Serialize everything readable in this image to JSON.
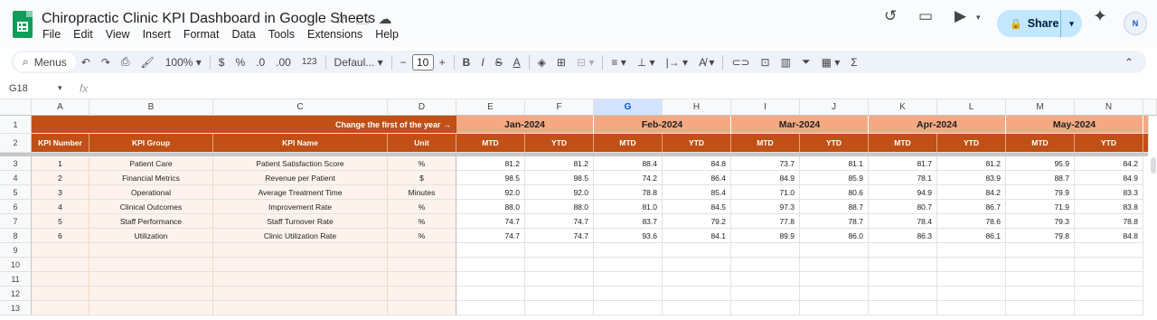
{
  "app": {
    "doc_title": "Chiropractic Clinic KPI Dashboard in Google Sheets",
    "menu": [
      "File",
      "Edit",
      "View",
      "Insert",
      "Format",
      "Data",
      "Tools",
      "Extensions",
      "Help"
    ],
    "share_label": "Share",
    "avatar_text": "N"
  },
  "toolbar": {
    "menus_label": "Menus",
    "zoom": "100%",
    "currency": "$",
    "percent": "%",
    "dec_decrease": ".0",
    "dec_increase": ".00",
    "number_format": "123",
    "font": "Defaul...",
    "font_size": "10"
  },
  "formula_bar": {
    "cell_ref": "G18",
    "fx": "fx"
  },
  "columns": [
    "A",
    "B",
    "C",
    "D",
    "E",
    "F",
    "G",
    "H",
    "I",
    "J",
    "K",
    "L",
    "M",
    "N"
  ],
  "selected_column": "G",
  "rows": [
    "1",
    "2",
    "3",
    "4",
    "5",
    "6",
    "7",
    "8",
    "9",
    "10",
    "11",
    "12",
    "13"
  ],
  "banner": {
    "note": "Change the first of the year →",
    "months": [
      "Jan-2024",
      "Feb-2024",
      "Mar-2024",
      "Apr-2024",
      "May-2024"
    ]
  },
  "header_row": {
    "kpi_number": "KPI Number",
    "kpi_group": "KPI Group",
    "kpi_name": "KPI Name",
    "unit": "Unit",
    "mtd": "MTD",
    "ytd": "YTD"
  },
  "kpis": [
    {
      "number": "1",
      "group": "Patient Care",
      "name": "Patient Satisfaction Score",
      "unit": "%",
      "values": [
        "81.2",
        "81.2",
        "88.4",
        "84.8",
        "73.7",
        "81.1",
        "81.7",
        "81.2",
        "95.9",
        "84.2"
      ]
    },
    {
      "number": "2",
      "group": "Financial Metrics",
      "name": "Revenue per Patient",
      "unit": "$",
      "values": [
        "98.5",
        "98.5",
        "74.2",
        "86.4",
        "84.9",
        "85.9",
        "78.1",
        "83.9",
        "88.7",
        "84.9"
      ]
    },
    {
      "number": "3",
      "group": "Operational",
      "name": "Average Treatment Time",
      "unit": "Minutes",
      "values": [
        "92.0",
        "92.0",
        "78.8",
        "85.4",
        "71.0",
        "80.6",
        "94.9",
        "84.2",
        "79.9",
        "83.3"
      ]
    },
    {
      "number": "4",
      "group": "Clinical Outcomes",
      "name": "Improvement Rate",
      "unit": "%",
      "values": [
        "88.0",
        "88.0",
        "81.0",
        "84.5",
        "97.3",
        "88.7",
        "80.7",
        "86.7",
        "71.9",
        "83.8"
      ]
    },
    {
      "number": "5",
      "group": "Staff Performance",
      "name": "Staff Turnover Rate",
      "unit": "%",
      "values": [
        "74.7",
        "74.7",
        "83.7",
        "79.2",
        "77.8",
        "78.7",
        "78.4",
        "78.6",
        "79.3",
        "78.8"
      ]
    },
    {
      "number": "6",
      "group": "Utilization",
      "name": "Clinic Utilization Rate",
      "unit": "%",
      "values": [
        "74.7",
        "74.7",
        "93.6",
        "84.1",
        "89.9",
        "86.0",
        "86.3",
        "86.1",
        "79.8",
        "84.8"
      ]
    }
  ],
  "colors": {
    "header_dark": "#c05015",
    "banner_light": "#f4a983",
    "data_fill": "#fdf3ec",
    "selected_col": "#d3e3fd"
  }
}
